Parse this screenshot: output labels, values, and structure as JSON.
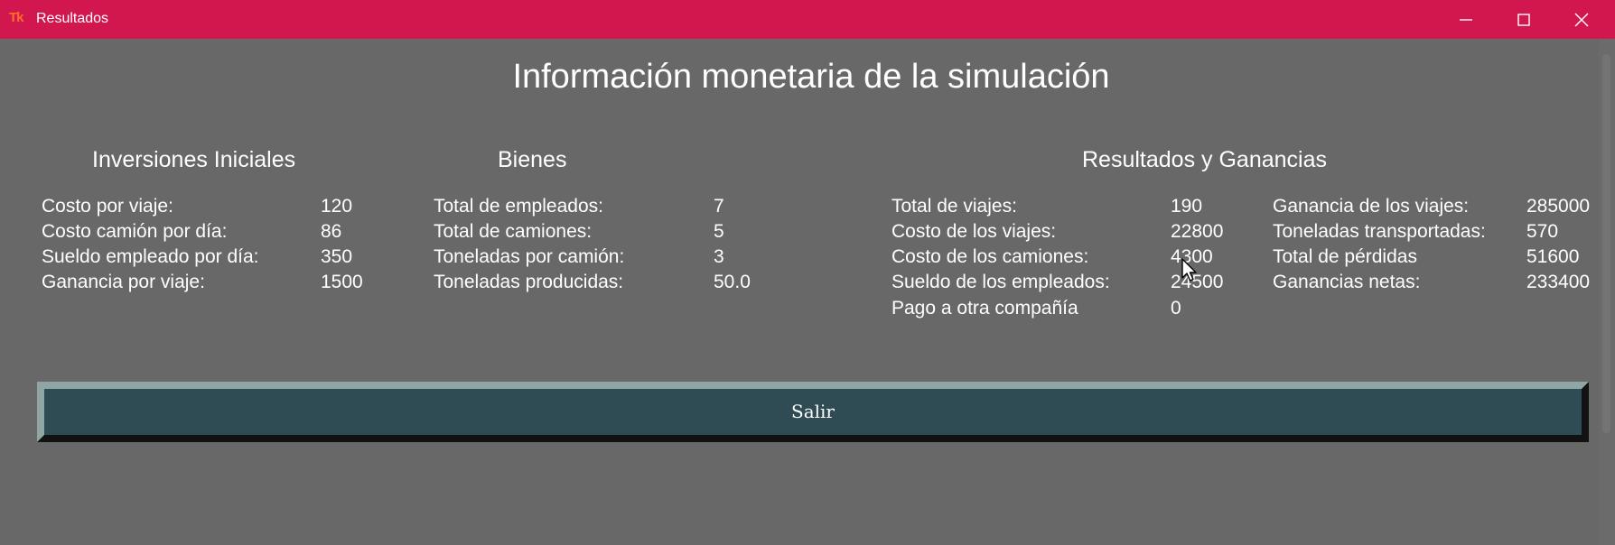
{
  "window": {
    "icon_text": "Tk",
    "title": "Resultados"
  },
  "main": {
    "title": "Información monetaria de la simulación"
  },
  "inversiones": {
    "title": "Inversiones Iniciales",
    "rows": [
      {
        "label": "Costo por viaje:",
        "value": "120"
      },
      {
        "label": "Costo camión por día:",
        "value": "86"
      },
      {
        "label": "Sueldo empleado por día:",
        "value": "350"
      },
      {
        "label": "Ganancia por viaje:",
        "value": "1500"
      }
    ]
  },
  "bienes": {
    "title": "Bienes",
    "rows": [
      {
        "label": "Total de empleados:",
        "value": "7"
      },
      {
        "label": "Total de camiones:",
        "value": "5"
      },
      {
        "label": "Toneladas por camión:",
        "value": "3"
      },
      {
        "label": "Toneladas producidas:",
        "value": "50.0"
      }
    ]
  },
  "resultados": {
    "title": "Resultados y Ganancias",
    "left_rows": [
      {
        "label": "Total de viajes:",
        "value": "190"
      },
      {
        "label": "Costo de los viajes:",
        "value": "22800"
      },
      {
        "label": "Costo de los camiones:",
        "value": "4300"
      },
      {
        "label": "Sueldo de los empleados:",
        "value": "24500"
      },
      {
        "label": "Pago a otra compañía",
        "value": "0"
      }
    ],
    "right_rows": [
      {
        "label": "Ganancia de los viajes:",
        "value": "285000"
      },
      {
        "label": "Toneladas transportadas:",
        "value": "570"
      },
      {
        "label": "Total de pérdidas",
        "value": "51600"
      },
      {
        "label": "Ganancias netas:",
        "value": "233400"
      }
    ]
  },
  "actions": {
    "exit_label": "Salir"
  },
  "colors": {
    "titlebar": "#d2174f",
    "background": "#686868",
    "button_face": "#2f4b53"
  }
}
